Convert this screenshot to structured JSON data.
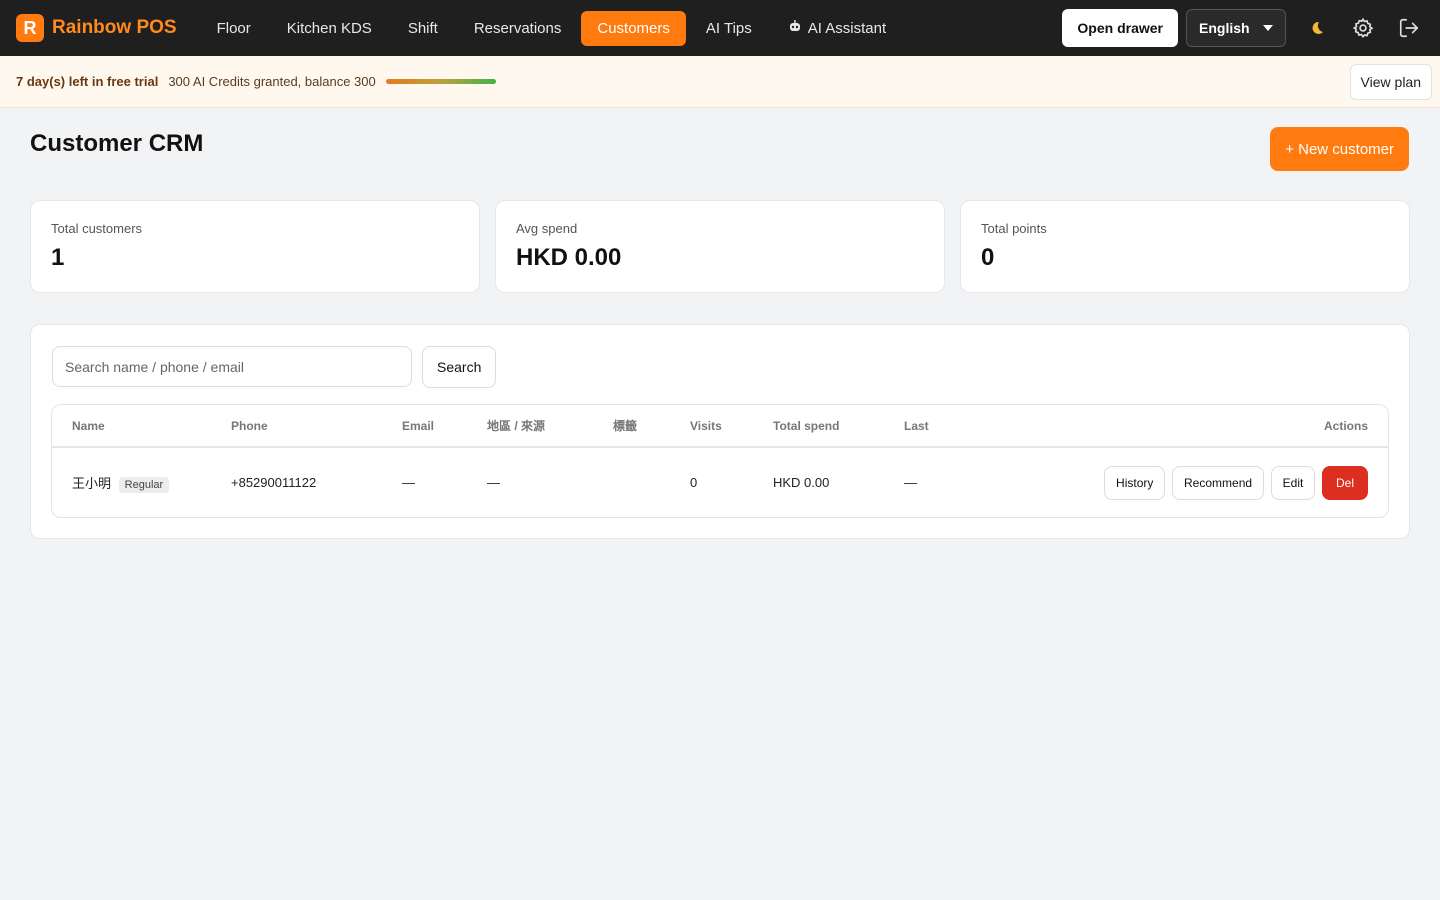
{
  "brand": {
    "logo_letter": "R",
    "name": "Rainbow POS",
    "accent": "#ff7a0f"
  },
  "nav": {
    "items": [
      {
        "label": "Floor"
      },
      {
        "label": "Kitchen KDS"
      },
      {
        "label": "Shift"
      },
      {
        "label": "Reservations"
      },
      {
        "label": "Customers",
        "active": true
      },
      {
        "label": "AI Tips"
      },
      {
        "label": "AI Assistant",
        "icon": "robot-icon"
      }
    ],
    "open_drawer": "Open drawer",
    "language": "English",
    "icons": [
      "moon-icon",
      "gear-icon",
      "logout-icon"
    ]
  },
  "trial": {
    "headline": "7 day(s) left in free trial",
    "credits": "300 AI Credits granted, balance 300",
    "view_plan": "View plan"
  },
  "page": {
    "title": "Customer CRM",
    "new_button": "+ New customer"
  },
  "stats": [
    {
      "label": "Total customers",
      "value": "1"
    },
    {
      "label": "Avg spend",
      "value": "HKD 0.00"
    },
    {
      "label": "Total points",
      "value": "0"
    }
  ],
  "search": {
    "placeholder": "Search name / phone / email",
    "button": "Search"
  },
  "table": {
    "headers": [
      "Name",
      "Phone",
      "Email",
      "地區 / 來源",
      "標籤",
      "Visits",
      "Total spend",
      "Last",
      "Actions"
    ],
    "rows": [
      {
        "name": "王小明",
        "tier": "Regular",
        "phone": "+85290011122",
        "email": "—",
        "region": "—",
        "tags": "",
        "visits": "0",
        "total_spend": "HKD 0.00",
        "last": "—",
        "actions": [
          "History",
          "Recommend",
          "Edit",
          "Del"
        ]
      }
    ]
  },
  "colors": {
    "danger": "#dc2f1f",
    "topbar": "#1f1f1f"
  }
}
